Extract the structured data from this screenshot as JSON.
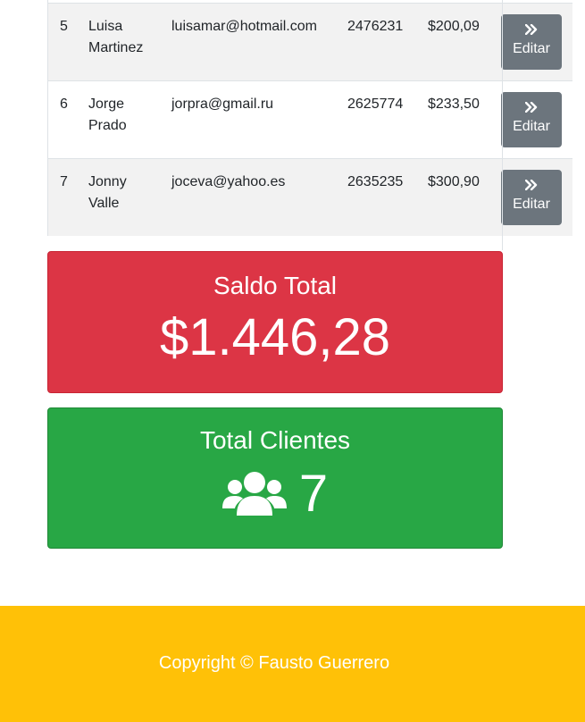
{
  "table": {
    "rows": [
      {
        "num": "5",
        "name": "Luisa Martinez",
        "email": "luisamar@hotmail.com",
        "phone": "2476231",
        "balance": "$200,09",
        "action": "Editar"
      },
      {
        "num": "6",
        "name": "Jorge Prado",
        "email": "jorpra@gmail.ru",
        "phone": "2625774",
        "balance": "$233,50",
        "action": "Editar"
      },
      {
        "num": "7",
        "name": "Jonny Valle",
        "email": "joceva@yahoo.es",
        "phone": "2635235",
        "balance": "$300,90",
        "action": "Editar"
      }
    ]
  },
  "saldo_card": {
    "title": "Saldo Total",
    "value": "$1.446,28",
    "color": "#dc3545"
  },
  "clientes_card": {
    "title": "Total Clientes",
    "icon": "users-icon",
    "value": "7",
    "color": "#28a745"
  },
  "footer": {
    "text": "Copyright © Fausto Guerrero",
    "color": "#ffc107"
  },
  "icons": {
    "edit": "angle-double-right-icon"
  }
}
